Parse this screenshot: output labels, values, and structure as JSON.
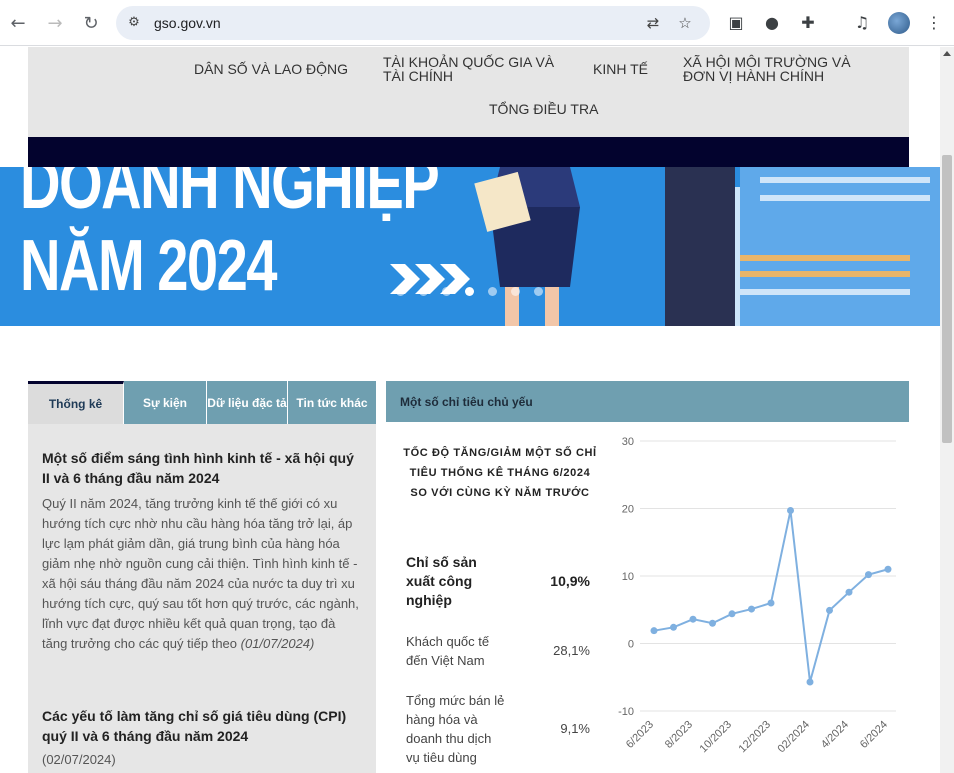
{
  "browser": {
    "url": "gso.gov.vn"
  },
  "nav": {
    "items": [
      "DÂN SỐ VÀ LAO ĐỘNG",
      "TÀI KHOẢN QUỐC GIA VÀ",
      "TÀI CHÍNH",
      "KINH TẾ",
      "XÃ HỘI MÔI TRƯỜNG VÀ",
      "ĐƠN VỊ HÀNH CHÍNH",
      "TỔNG ĐIỀU TRA"
    ]
  },
  "banner": {
    "line1": "DOANH NGHIỆP",
    "line2": "NĂM  2024",
    "slides": 7,
    "active_slide": 4
  },
  "tabs": [
    "Thống kê",
    "Sự kiện",
    "Dữ liệu đặc tả",
    "Tin tức khác"
  ],
  "news": [
    {
      "title": "Một số điểm sáng tình hình kinh tế - xã hội quý II và 6 tháng đầu năm 2024",
      "body": "Quý II năm 2024, tăng trưởng kinh tế thế giới có xu hướng tích cực nhờ nhu cầu hàng hóa tăng trở lại, áp lực lạm phát giảm dần, giá trung bình của hàng hóa giảm nhẹ nhờ nguồn cung cải thiện. Tình hình kinh tế - xã hội sáu tháng đầu năm 2024 của nước ta duy trì xu hướng tích cực, quý sau tốt hơn quý trước, các ngành, lĩnh vực đạt được nhiều kết quả quan trọng, tạo đà tăng trưởng cho các quý tiếp theo",
      "date": "(01/07/2024)"
    },
    {
      "title": "Các yếu tố làm tăng chỉ số giá tiêu dùng (CPI) quý II và 6 tháng đầu năm 2024",
      "date": "(02/07/2024)"
    }
  ],
  "indicators": {
    "header": "Một số chỉ tiêu chủ yếu",
    "title": "TỐC ĐỘ TĂNG/GIẢM MỘT SỐ CHỈ TIÊU THỐNG KÊ THÁNG 6/2024 SO VỚI CÙNG KỲ NĂM TRƯỚC",
    "rows": [
      {
        "name": "Chỉ số sản xuất công nghiệp",
        "value": "10,9%"
      },
      {
        "name": "Khách quốc tế đến Việt Nam",
        "value": "28,1%"
      },
      {
        "name": "Tổng mức bán lẻ hàng hóa và doanh thu dịch vụ tiêu dùng",
        "value": "9,1%"
      }
    ]
  },
  "chart_data": {
    "type": "line",
    "x": [
      "6/2023",
      "7/2023",
      "8/2023",
      "9/2023",
      "10/2023",
      "11/2023",
      "12/2023",
      "01/2024",
      "02/2024",
      "3/2024",
      "4/2024",
      "5/2024",
      "6/2024"
    ],
    "x_tick_labels": [
      "6/2023",
      "8/2023",
      "10/2023",
      "12/2023",
      "02/2024",
      "4/2024",
      "6/2024"
    ],
    "series": [
      {
        "values": [
          1.9,
          2.4,
          3.6,
          3.0,
          4.4,
          5.1,
          6.0,
          19.7,
          -5.7,
          4.9,
          7.6,
          10.2,
          11.0
        ],
        "color": "#7fb0e0"
      }
    ],
    "ylim": [
      -10,
      30
    ],
    "yticks": [
      30,
      20,
      10,
      0,
      -10
    ],
    "grid": true,
    "legend": "none"
  }
}
